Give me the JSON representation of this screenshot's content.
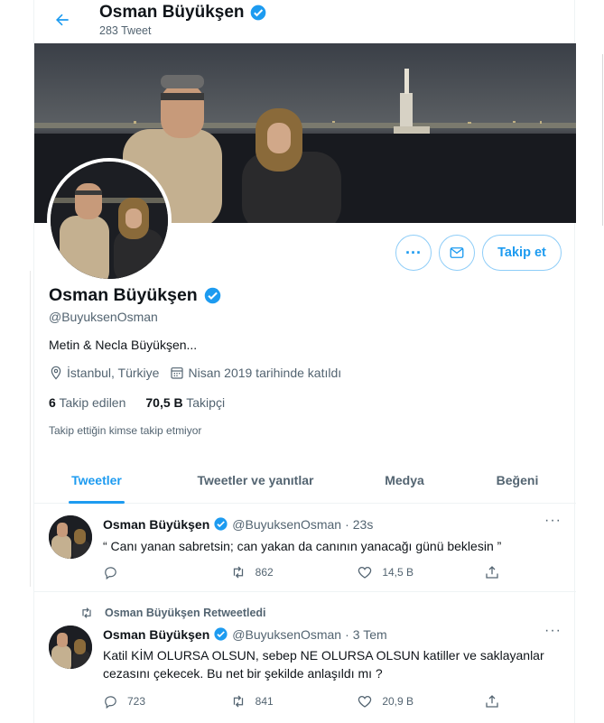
{
  "colors": {
    "accent": "#1d9bf0",
    "text": "#0f1419",
    "muted": "#536471",
    "border": "#eff3f4"
  },
  "header": {
    "title": "Osman Büyükşen",
    "tweet_count": "283 Tweet",
    "back_icon": "arrow-left-icon"
  },
  "profile": {
    "name": "Osman Büyükşen",
    "handle": "@BuyuksenOsman",
    "bio": "Metin & Necla Büyükşen...",
    "location": "İstanbul, Türkiye",
    "joined": "Nisan 2019 tarihinde katıldı",
    "following_count": "6",
    "following_label": "Takip edilen",
    "followers_count": "70,5 B",
    "followers_label": "Takipçi",
    "follow_note": "Takip ettiğin kimse takip etmiyor",
    "follow_button": "Takip et"
  },
  "tabs": [
    {
      "label": "Tweetler",
      "active": true
    },
    {
      "label": "Tweetler ve yanıtlar",
      "active": false
    },
    {
      "label": "Medya",
      "active": false
    },
    {
      "label": "Beğeni",
      "active": false
    }
  ],
  "tweets": [
    {
      "name": "Osman Büyükşen",
      "handle": "@BuyuksenOsman",
      "sep": "·",
      "time": "23s",
      "text": "“ Canı yanan sabretsin; can yakan da canının yanacağı günü beklesin ”",
      "replies": "",
      "retweets": "862",
      "likes": "14,5 B"
    },
    {
      "retweet_label": "Osman Büyükşen Retweetledi",
      "name": "Osman Büyükşen",
      "handle": "@BuyuksenOsman",
      "sep": "·",
      "time": "3 Tem",
      "text": "Katil KİM OLURSA OLSUN, sebep NE OLURSA OLSUN katiller ve saklayanlar cezasını çekecek. Bu net bir şekilde anlaşıldı mı ?",
      "replies": "723",
      "retweets": "841",
      "likes": "20,9 B"
    }
  ]
}
